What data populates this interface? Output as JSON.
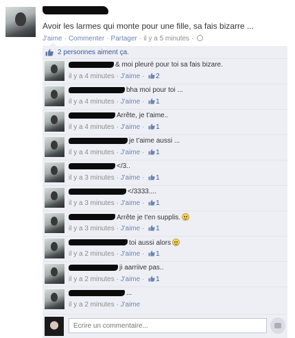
{
  "post": {
    "text": "Avoir les larmes qui monte pour une fille, sa fais bizarre ...",
    "actions": {
      "like": "J'aime",
      "comment": "Commenter",
      "share": "Partager",
      "time": "il y a 5 minutes"
    },
    "likes_text": "2 personnes aiment ça."
  },
  "comments": [
    {
      "text": "& moi pleuré pour toi sa fais bizare.",
      "time": "il y a 4 minutes",
      "like": "J'aime",
      "count": "2",
      "smiley": false
    },
    {
      "text": "bha moi pour toi ...",
      "time": "il y a 4 minutes",
      "like": "J'aime",
      "count": "1",
      "smiley": false
    },
    {
      "text": "Arrête, je t'aime..",
      "time": "il y a 4 minutes",
      "like": "J'aime",
      "count": "1",
      "smiley": false
    },
    {
      "text": "je t'aime aussi ...",
      "time": "il y a 4 minutes",
      "like": "J'aime",
      "count": "1",
      "smiley": false
    },
    {
      "text": "</3..",
      "time": "il y a 3 minutes",
      "like": "J'aime",
      "count": "1",
      "smiley": false
    },
    {
      "text": "</3333....",
      "time": "il y a 3 minutes",
      "like": "J'aime",
      "count": "1",
      "smiley": false
    },
    {
      "text": "Arrête je t'en supplis.",
      "time": "il y a 3 minutes",
      "like": "J'aime",
      "count": "1",
      "smiley": true
    },
    {
      "text": "toi aussi alors",
      "time": "il y a 2 minutes",
      "like": "J'aime",
      "count": "1",
      "smiley": true
    },
    {
      "text": "ji aarriive pas..",
      "time": "il y a 2 minutes",
      "like": "J'aime",
      "count": "1",
      "smiley": false
    },
    {
      "text": "...",
      "time": "il y a 2 minutes",
      "like": "J'aime",
      "count": "",
      "smiley": false
    }
  ],
  "write_comment": {
    "placeholder": "Écrire un commentaire..."
  },
  "icons": {
    "like": "thumbs-up-icon",
    "privacy": "globe-icon",
    "emoji": "smiley-icon",
    "photo": "camera-icon"
  },
  "colors": {
    "link": "#6d84b4",
    "brand": "#3b5998",
    "feedback_bg": "#edeff4"
  }
}
